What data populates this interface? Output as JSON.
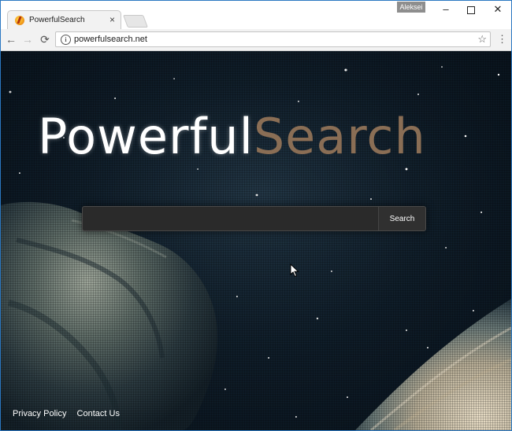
{
  "browser": {
    "tab_title": "PowerfulSearch",
    "tab_close": "×",
    "user_badge": "Aleksei",
    "minimize": "–",
    "close": "✕",
    "back": "←",
    "forward": "→",
    "reload": "⟳",
    "url": "powerfulsearch.net",
    "info": "i",
    "star": "☆",
    "menu": "⋮"
  },
  "page": {
    "logo_part1": "Powerful",
    "logo_part2": "Search",
    "search_placeholder": "",
    "search_button_label": "Search",
    "footer": {
      "privacy_label": "Privacy Policy",
      "contact_label": "Contact Us"
    }
  },
  "colors": {
    "window_border": "#2b78c2",
    "logo_white": "#ffffff",
    "logo_brown": "#8a6e55",
    "background_dark": "#0f1d29"
  },
  "icons": {
    "favicon": "powerfulsearch-favicon-icon",
    "back": "arrow-left-icon",
    "forward": "arrow-right-icon",
    "reload": "reload-icon",
    "info": "info-circle-icon",
    "star": "star-icon",
    "menu": "kebab-menu-icon"
  }
}
